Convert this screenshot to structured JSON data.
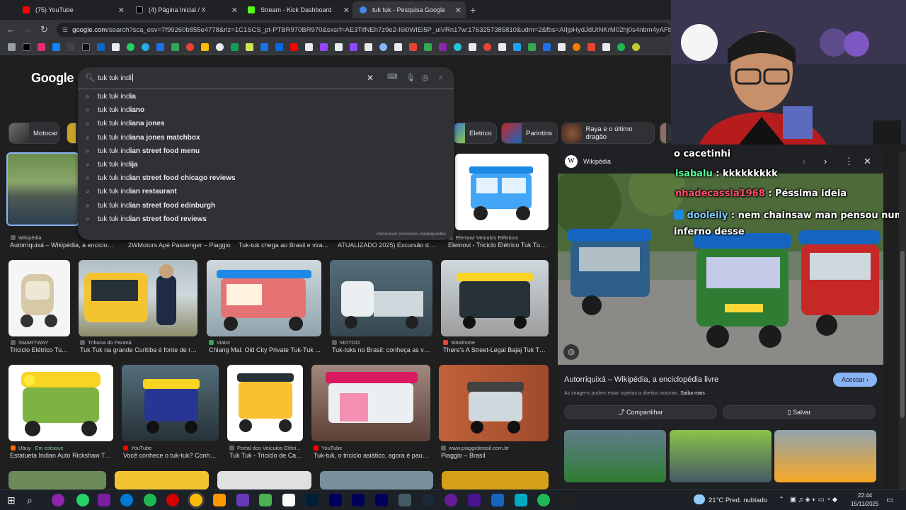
{
  "tabs": [
    {
      "title": "(75) YouTube",
      "color": "#ff0000"
    },
    {
      "title": "(4) Página Inicial / X",
      "color": "#000000"
    },
    {
      "title": "Stream - Kick Dashboard",
      "color": "#53fc18"
    },
    {
      "title": "tuk tuk - Pesquisa Google",
      "color": "#4285f4"
    }
  ],
  "address": {
    "domain": "google.com",
    "path": "/search?sca_esv=7f99260b855e4778&rlz=1C1SCS_pt-PTBR970BR970&sxsrf=AE3TifNEh7z9e2-I6l0WIEi5P_uiVRn17w:1763257385810&udm=2&fbs=AIIjpHydJdUtNKrM02hj0s4nbm4yAFb4PvhjIU"
  },
  "google": {
    "logo": "Google",
    "query": "tuk tuk indi",
    "suggestions": [
      {
        "typed": "tuk tuk ind",
        "rest": "ia"
      },
      {
        "typed": "tuk tuk ind",
        "rest": "iano"
      },
      {
        "typed": "tuk tuk ind",
        "rest": "iana jones"
      },
      {
        "typed": "tuk tuk ind",
        "rest": "iana jones matchbox"
      },
      {
        "typed": "tuk tuk ind",
        "rest": "ian street food menu"
      },
      {
        "typed": "tuk tuk ind",
        "rest": "ija"
      },
      {
        "typed": "tuk tuk ind",
        "rest": "ian street food chicago reviews"
      },
      {
        "typed": "tuk tuk ind",
        "rest": "ian restaurant"
      },
      {
        "typed": "tuk tuk ind",
        "rest": "ian street food edinburgh"
      },
      {
        "typed": "tuk tuk ind",
        "rest": "ian street food reviews"
      }
    ],
    "report": "Denunciar previsões inadequadas",
    "chips": [
      "Motocar",
      "Eletrico",
      "Parintins",
      "Raya e o último dragão"
    ]
  },
  "results": {
    "row1": [
      {
        "source": "Wikipédia",
        "title": "Autorriquixá – Wikipédia, a enciclop..."
      },
      {
        "source": "",
        "title": "2WMotors Apé Passenger – Piaggio"
      },
      {
        "source": "",
        "title": "Tuk-tuk chega ao Brasil e vira..."
      },
      {
        "source": "",
        "title": "ATUALIZADO 2025) Excursão da..."
      },
      {
        "source": "Elemovi Veículos Elétricos",
        "title": "Elemovi - Triciclo Elétrico Tuk Tuk..."
      }
    ],
    "row2": [
      {
        "source": "SMARTWAY",
        "title": "Triciclo Elétrico Tu..."
      },
      {
        "source": "Tribuna do Paraná",
        "title": "Tuk Tuk na grande Curitiba é fonte de re..."
      },
      {
        "source": "Viator",
        "title": "Chiang Mai: Old City Private Tuk-Tuk ..."
      },
      {
        "source": "MOTOO",
        "title": "Tuk-tuks no Brasil: conheça as va..."
      },
      {
        "source": "Sitodrome",
        "title": "There's A Street-Legal Bajaj Tuk Tu..."
      }
    ],
    "row3": [
      {
        "source": "Ubuy",
        "stock": "Em estoque",
        "title": "Estatueta Indian Auto Rickshaw Tu..."
      },
      {
        "source": "YouTube",
        "title": "Você conhece o tuk-tuk? Conhe..."
      },
      {
        "source": "Portal dos Veículos Elétri...",
        "title": "Tuk Tuk - Triciclo de Car..."
      },
      {
        "source": "YouTube",
        "title": "Tuk-tuk, o triciclo asiático, agora é pauli..."
      },
      {
        "source": "www.piaggiobrasil.com.br",
        "title": "Piaggio – Brasil"
      }
    ]
  },
  "panel": {
    "source": "Wikipédia",
    "title": "Autorriquixá – Wikipédia, a enciclopédia livre",
    "visit": "Acessar",
    "note": "As imagens podem estar sujeitas a direitos autorais.",
    "learn": "Saiba mais",
    "share": "Compartilhar",
    "save": "Salvar"
  },
  "chat": [
    {
      "user": "",
      "text": "o cacetinhi",
      "user_color": "#ffffff"
    },
    {
      "user": "isabalu",
      "text": ": kkkkkkkkk",
      "user_color": "#5dffa1"
    },
    {
      "user": "nhadecassia1968",
      "text": ": Péssima ideia",
      "user_color": "#ff4d6d"
    },
    {
      "user": "dooleiiy",
      "text": ": nem chainsaw man pensou num",
      "user_color": "#7ec8ff"
    },
    {
      "user": "",
      "text": "inferno desse",
      "user_color": "#ffffff"
    }
  ],
  "tray": {
    "weather": "21°C  Pred. nublado",
    "time": "22:44",
    "date": "15/11/2025"
  }
}
